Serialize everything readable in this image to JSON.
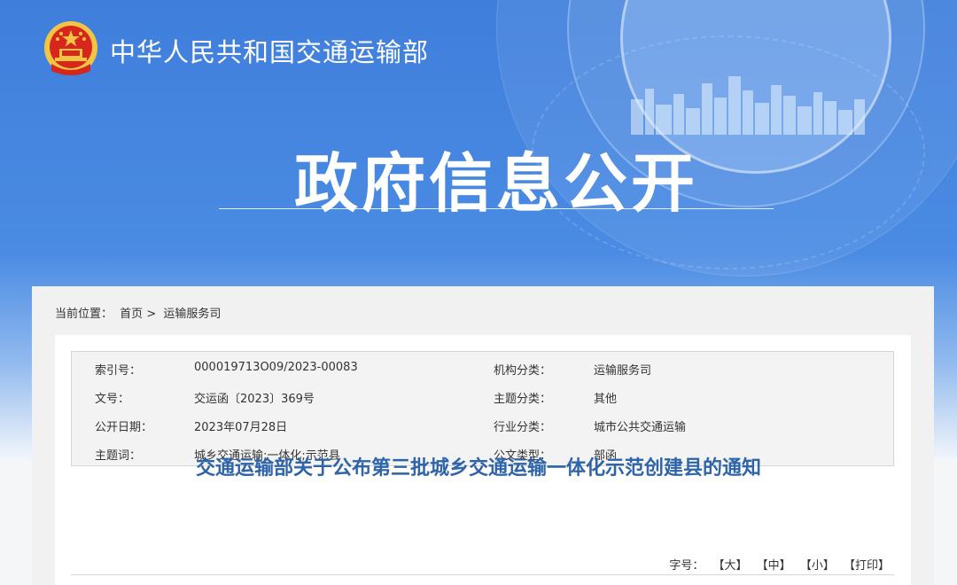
{
  "header": {
    "site_name": "中华人民共和国交通运输部",
    "hero_title": "政府信息公开"
  },
  "breadcrumb": {
    "label": "当前位置：",
    "home": "首页",
    "separator": ">",
    "current": "运输服务司"
  },
  "metadata": {
    "rows": [
      {
        "label1": "索引号：",
        "value1": "000019713O09/2023-00083",
        "label2": "机构分类：",
        "value2": "运输服务司"
      },
      {
        "label1": "文号：",
        "value1": "交运函〔2023〕369号",
        "label2": "主题分类：",
        "value2": "其他"
      },
      {
        "label1": "公开日期：",
        "value1": "2023年07月28日",
        "label2": "行业分类：",
        "value2": "城市公共交通运输"
      },
      {
        "label1": "主题词：",
        "value1": "城乡交通运输;一体化;示范县",
        "label2": "公文类型：",
        "value2": "部函"
      }
    ]
  },
  "document": {
    "title": "交通运输部关于公布第三批城乡交通运输一体化示范创建县的通知"
  },
  "font_size": {
    "label": "字号：",
    "large": "【大】",
    "medium": "【中】",
    "small": "【小】",
    "print": "【打印】"
  },
  "colors": {
    "banner_blue": "#4a8be3",
    "title_blue": "#2e64a8",
    "emblem_red": "#d7261c",
    "emblem_gold": "#f3c545"
  }
}
